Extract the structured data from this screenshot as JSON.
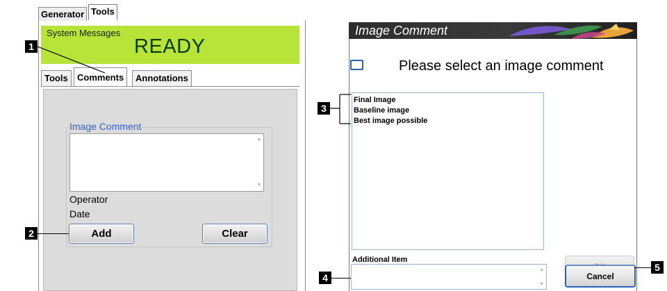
{
  "left_panel": {
    "top_tabs": [
      "Generator",
      "Tools"
    ],
    "system_messages": {
      "title": "System Messages",
      "status": "READY",
      "color": "#b8e43a"
    },
    "sub_tabs": [
      "Tools",
      "Comments",
      "Annotations"
    ],
    "image_comment": {
      "legend": "Image Comment",
      "operator_label": "Operator",
      "date_label": "Date",
      "add_button": "Add",
      "clear_button": "Clear"
    }
  },
  "dialog": {
    "title": "Image Comment",
    "prompt": "Please select an image comment",
    "comments": [
      "Final Image",
      "Baseline image",
      "Best image possible"
    ],
    "additional_label": "Additional Item",
    "ok_button": "OK",
    "cancel_button": "Cancel"
  },
  "callouts": [
    "1",
    "2",
    "3",
    "4",
    "5"
  ],
  "icons": {
    "checkbox": "checkbox-icon",
    "scroll_up": "scroll-up-arrow-icon",
    "scroll_down": "scroll-down-arrow-icon"
  }
}
